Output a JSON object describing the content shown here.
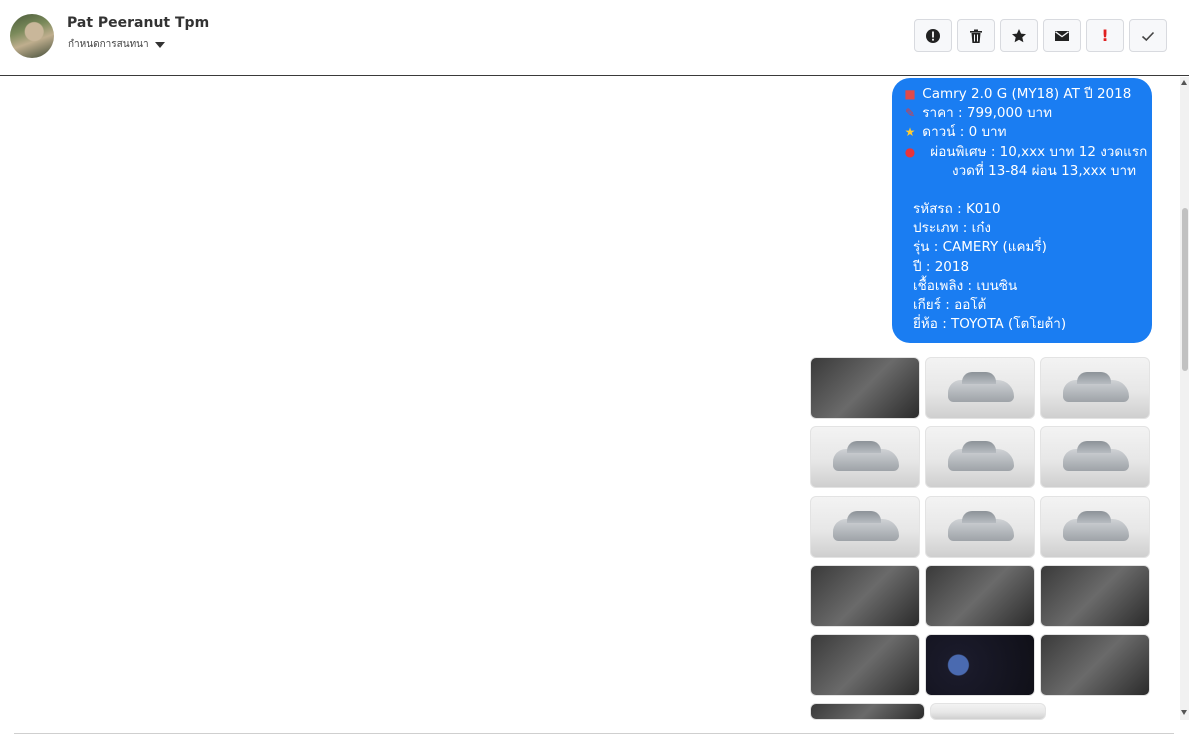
{
  "header": {
    "contact_name": "Pat Peeranut Tpm",
    "subtitle": "กำหนดการสนทนา",
    "actions": [
      {
        "name": "report-button",
        "icon": "alert-circle-icon"
      },
      {
        "name": "delete-button",
        "icon": "trash-icon"
      },
      {
        "name": "star-button",
        "icon": "star-icon"
      },
      {
        "name": "mail-button",
        "icon": "envelope-icon"
      },
      {
        "name": "important-button",
        "icon": "exclamation-icon",
        "label": "!"
      },
      {
        "name": "done-button",
        "icon": "check-icon"
      }
    ]
  },
  "message": {
    "title": "Camry 2.0 G (MY18) AT ปี 2018",
    "price": "ราคา : 799,000 บาท",
    "down": "ดาวน์ : 0 บาท",
    "installment_1": "ผ่อนพิเศษ : 10,xxx บาท 12 งวดแรก",
    "installment_2": "งวดที่ 13-84 ผ่อน 13,xxx บาท",
    "code": "รหัสรถ : K010",
    "type": "ประเภท : เก๋ง",
    "model": "รุ่น : CAMERY (แคมรี่)",
    "year": "ปี : 2018",
    "fuel": "เชื้อเพลิง : เบนซิน",
    "gear": "เกียร์ : ออโต้",
    "brand": "ยี่ห้อ : TOYOTA (โตโยต้า)"
  },
  "photos": {
    "count_visible": 17
  },
  "colors": {
    "bubble": "#1a7df2",
    "important": "#e02020"
  }
}
